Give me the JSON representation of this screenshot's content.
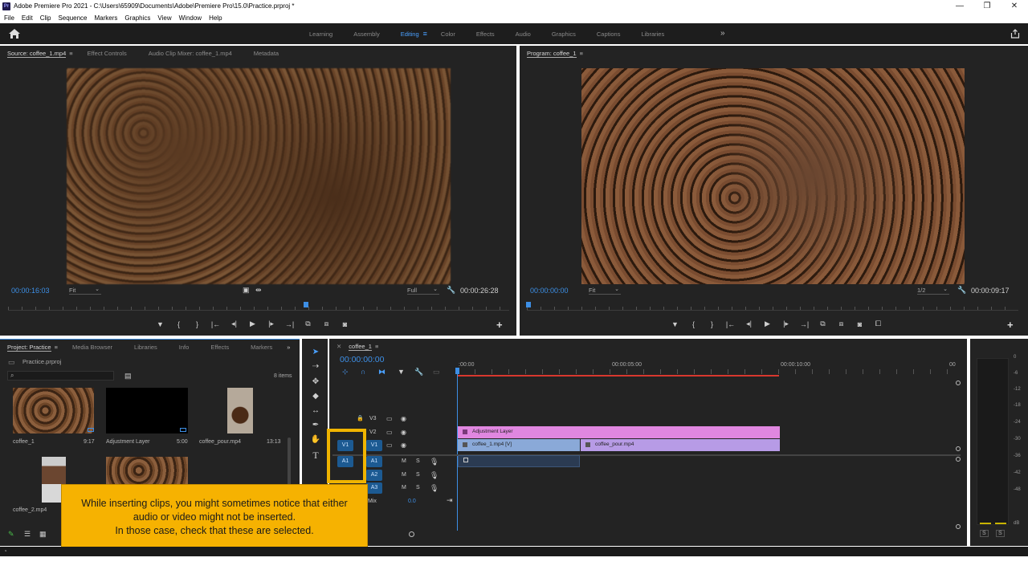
{
  "window": {
    "title": "Adobe Premiere Pro 2021 - C:\\Users\\65909\\Documents\\Adobe\\Premiere Pro\\15.0\\Practice.prproj *",
    "logo": "Pr",
    "controls": [
      "—",
      "❐",
      "✕"
    ]
  },
  "menu": [
    "File",
    "Edit",
    "Clip",
    "Sequence",
    "Markers",
    "Graphics",
    "View",
    "Window",
    "Help"
  ],
  "workspaces": {
    "tabs": [
      "Learning",
      "Assembly",
      "Editing",
      "Color",
      "Effects",
      "Audio",
      "Graphics",
      "Captions",
      "Libraries"
    ],
    "active": "Editing",
    "more": "»"
  },
  "source": {
    "tabs": [
      "Source: coffee_1.mp4",
      "Effect Controls",
      "Audio Clip Mixer: coffee_1.mp4",
      "Metadata"
    ],
    "timecode_in": "00:00:16:03",
    "fit": "Fit",
    "quality": "Full",
    "duration": "00:00:26:28",
    "transport": [
      "▼",
      "{",
      "}",
      "|←",
      "◂|",
      "▶",
      "|▸",
      "→|",
      "⧉",
      "⧈",
      "◙"
    ]
  },
  "program": {
    "tab": "Program: coffee_1",
    "timecode": "00:00:00:00",
    "fit": "Fit",
    "quality": "1/2",
    "duration": "00:00:09:17",
    "transport": [
      "▼",
      "{",
      "}",
      "|←",
      "◂|",
      "▶",
      "|▸",
      "→|",
      "⧉",
      "⧈",
      "◙",
      "⧠"
    ]
  },
  "project": {
    "tabs": [
      "Project: Practice",
      "Media Browser",
      "Libraries",
      "Info",
      "Effects",
      "Markers"
    ],
    "file": "Practice.prproj",
    "count": "8 items",
    "items": [
      {
        "name": "coffee_1",
        "duration": "9:17"
      },
      {
        "name": "Adjustment Layer",
        "duration": "5:00"
      },
      {
        "name": "coffee_pour.mp4",
        "duration": "13:13"
      },
      {
        "name": "coffee_2.mp4",
        "duration": ""
      }
    ]
  },
  "timeline": {
    "tab": "coffee_1",
    "timecode": "00:00:00:00",
    "ruler": [
      ":00:00",
      "00:00:05:00",
      "00:00:10:00",
      "00"
    ],
    "video_tracks": [
      "V3",
      "V2",
      "V1"
    ],
    "audio_tracks": [
      "A1",
      "A2",
      "A3"
    ],
    "track_buttons": [
      "M",
      "S"
    ],
    "mix_label": "Mix",
    "mix_value": "0.0",
    "source_patch_video": "V1",
    "source_patch_audio": "A1",
    "clips": {
      "adjustment": "Adjustment Layer",
      "v1_a": "coffee_1.mp4 [V]",
      "v1_b": "coffee_pour.mp4"
    }
  },
  "meter": {
    "scale": [
      "0",
      "-6",
      "-12",
      "-18",
      "-24",
      "-30",
      "-36",
      "-42",
      "-48",
      "dB"
    ],
    "solo": [
      "S",
      "S"
    ]
  },
  "callout": {
    "line1": "While inserting clips, you might sometimes notice that either",
    "line2": "audio or video might not be inserted.",
    "line3": "In those case, check that these are selected."
  },
  "colors": {
    "accent": "#3d8fe6",
    "callout": "#f6b201",
    "highlight": "#f0b400",
    "adjustment_clip": "#e087e0",
    "video_clip_a": "#8aa9d8",
    "video_clip_b": "#b79be6"
  }
}
